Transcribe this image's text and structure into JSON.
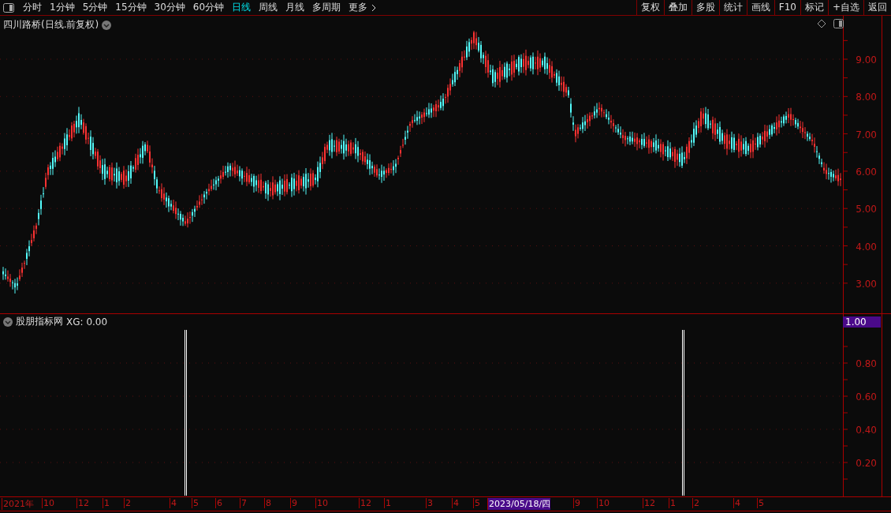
{
  "toolbar": {
    "periods": [
      {
        "label": "分时",
        "selected": false
      },
      {
        "label": "1分钟",
        "selected": false
      },
      {
        "label": "5分钟",
        "selected": false
      },
      {
        "label": "15分钟",
        "selected": false
      },
      {
        "label": "30分钟",
        "selected": false
      },
      {
        "label": "60分钟",
        "selected": false
      },
      {
        "label": "日线",
        "selected": true
      },
      {
        "label": "周线",
        "selected": false
      },
      {
        "label": "月线",
        "selected": false
      },
      {
        "label": "多周期",
        "selected": false
      }
    ],
    "more": "更多",
    "actions": [
      "复权",
      "叠加",
      "多股",
      "统计",
      "画线",
      "F10",
      "标记",
      "+自选",
      "返回"
    ]
  },
  "main_chart": {
    "title": "四川路桥(日线.前复权)",
    "price_ticks": [
      "9.00",
      "8.00",
      "7.00",
      "6.00",
      "5.00",
      "4.00",
      "3.00"
    ]
  },
  "indicator": {
    "title": "股朋指标网",
    "reading": "XG: 0.00",
    "current_value": "1.00",
    "ticks": [
      "0.80",
      "0.60",
      "0.40",
      "0.20"
    ]
  },
  "date_axis": {
    "labels": [
      {
        "label": "2021年",
        "selected": false
      },
      {
        "label": "10",
        "selected": false
      },
      {
        "label": "12",
        "selected": false
      },
      {
        "label": "1",
        "selected": false
      },
      {
        "label": "2",
        "selected": false
      },
      {
        "label": "4",
        "selected": false
      },
      {
        "label": "5",
        "selected": false
      },
      {
        "label": "6",
        "selected": false
      },
      {
        "label": "7",
        "selected": false
      },
      {
        "label": "8",
        "selected": false
      },
      {
        "label": "9",
        "selected": false
      },
      {
        "label": "10",
        "selected": false
      },
      {
        "label": "12",
        "selected": false
      },
      {
        "label": "1",
        "selected": false
      },
      {
        "label": "3",
        "selected": false
      },
      {
        "label": "4",
        "selected": false
      },
      {
        "label": "5",
        "selected": false
      },
      {
        "label": "2023/05/18/四",
        "selected": true
      },
      {
        "label": "9",
        "selected": false
      },
      {
        "label": "10",
        "selected": false
      },
      {
        "label": "12",
        "selected": false
      },
      {
        "label": "1",
        "selected": false
      },
      {
        "label": "2",
        "selected": false
      },
      {
        "label": "4",
        "selected": false
      },
      {
        "label": "5",
        "selected": false
      }
    ]
  }
}
